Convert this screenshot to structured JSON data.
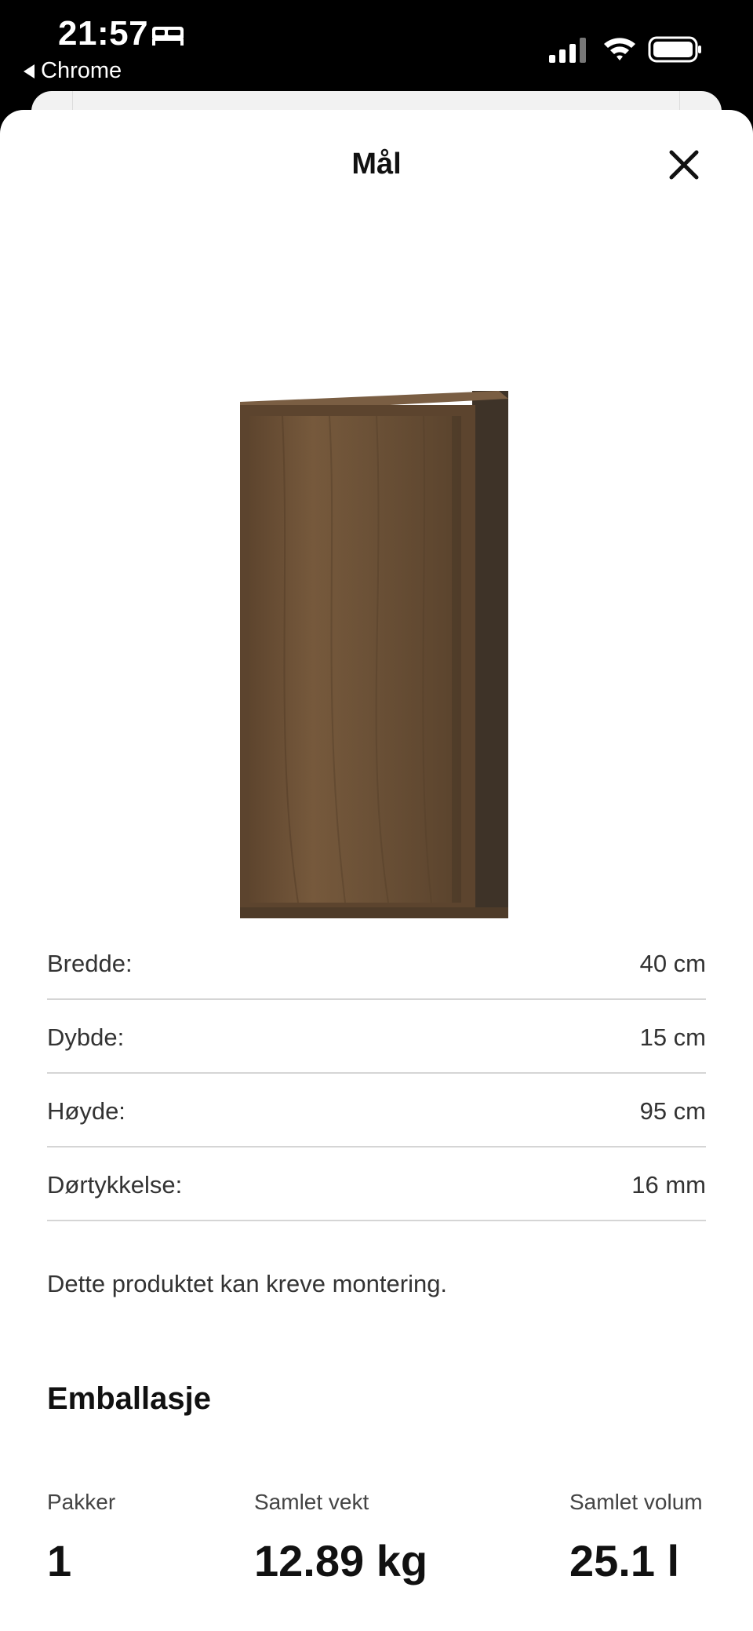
{
  "status_bar": {
    "time": "21:57",
    "back_app": "Chrome",
    "icons": [
      "bed-icon",
      "signal-icon",
      "wifi-icon",
      "battery-icon"
    ]
  },
  "sheet": {
    "title": "Mål",
    "close_icon": "close-icon"
  },
  "product_image": {
    "description_icon": "wall-cabinet-image",
    "colors": {
      "wood": "#6b5136",
      "wood_dark": "#4a3826",
      "side": "#3e3328"
    }
  },
  "dimensions": [
    {
      "label": "Bredde:",
      "value": "40 cm"
    },
    {
      "label": "Dybde:",
      "value": "15 cm"
    },
    {
      "label": "Høyde:",
      "value": "95 cm"
    },
    {
      "label": "Dørtykkelse:",
      "value": "16 mm"
    }
  ],
  "note": "Dette produktet kan kreve montering.",
  "packaging": {
    "heading": "Emballasje",
    "columns": [
      {
        "label": "Pakker",
        "value": "1"
      },
      {
        "label": "Samlet vekt",
        "value": "12.89 kg"
      },
      {
        "label": "Samlet volum",
        "value": "25.1 l"
      }
    ]
  }
}
